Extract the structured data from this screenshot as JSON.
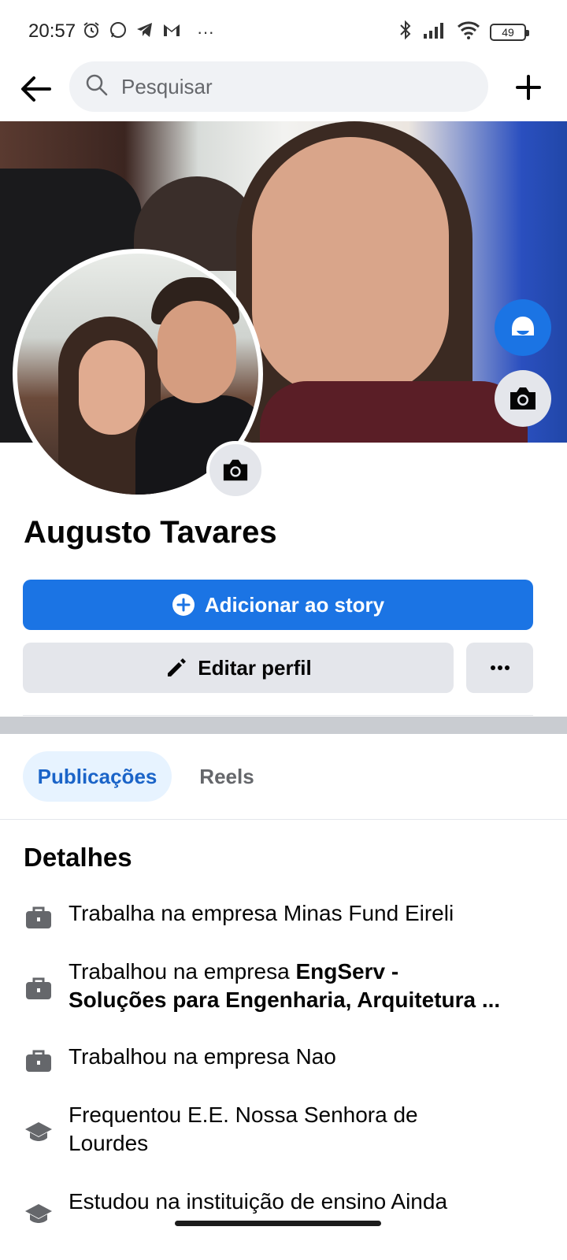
{
  "status_bar": {
    "time": "20:57",
    "more": "···",
    "battery": "49",
    "left_icons": [
      "alarm-icon",
      "whatsapp-icon",
      "telegram-icon",
      "gmail-icon"
    ],
    "right_icons": [
      "bluetooth-icon",
      "signal-icon",
      "wifi-icon",
      "battery-icon"
    ]
  },
  "top_bar": {
    "search_placeholder": "Pesquisar"
  },
  "profile": {
    "name": "Augusto Tavares"
  },
  "actions": {
    "add_story_label": "Adicionar ao story",
    "edit_profile_label": "Editar perfil"
  },
  "tabs": [
    {
      "label": "Publicações",
      "active": true
    },
    {
      "label": "Reels",
      "active": false
    }
  ],
  "details": {
    "title": "Detalhes",
    "items": [
      {
        "icon": "briefcase-icon",
        "prefix": "Trabalha na empresa Minas Fund Eireli",
        "bold": ""
      },
      {
        "icon": "briefcase-icon",
        "prefix": "Trabalhou na empresa ",
        "bold": "EngServ -",
        "bold_line2": "Soluções para Engenharia, Arquitetura ..."
      },
      {
        "icon": "briefcase-icon",
        "prefix": "Trabalhou na empresa Nao",
        "bold": ""
      },
      {
        "icon": "graduation-cap-icon",
        "prefix": "Frequentou E.E. Nossa Senhora de Lourdes",
        "bold": ""
      },
      {
        "icon": "graduation-cap-icon",
        "prefix": "Estudou na instituição de ensino Ainda",
        "bold": ""
      }
    ]
  },
  "colors": {
    "primary": "#1b74e4",
    "tab_active_bg": "#e7f3ff",
    "button_grey": "#e4e6eb"
  }
}
